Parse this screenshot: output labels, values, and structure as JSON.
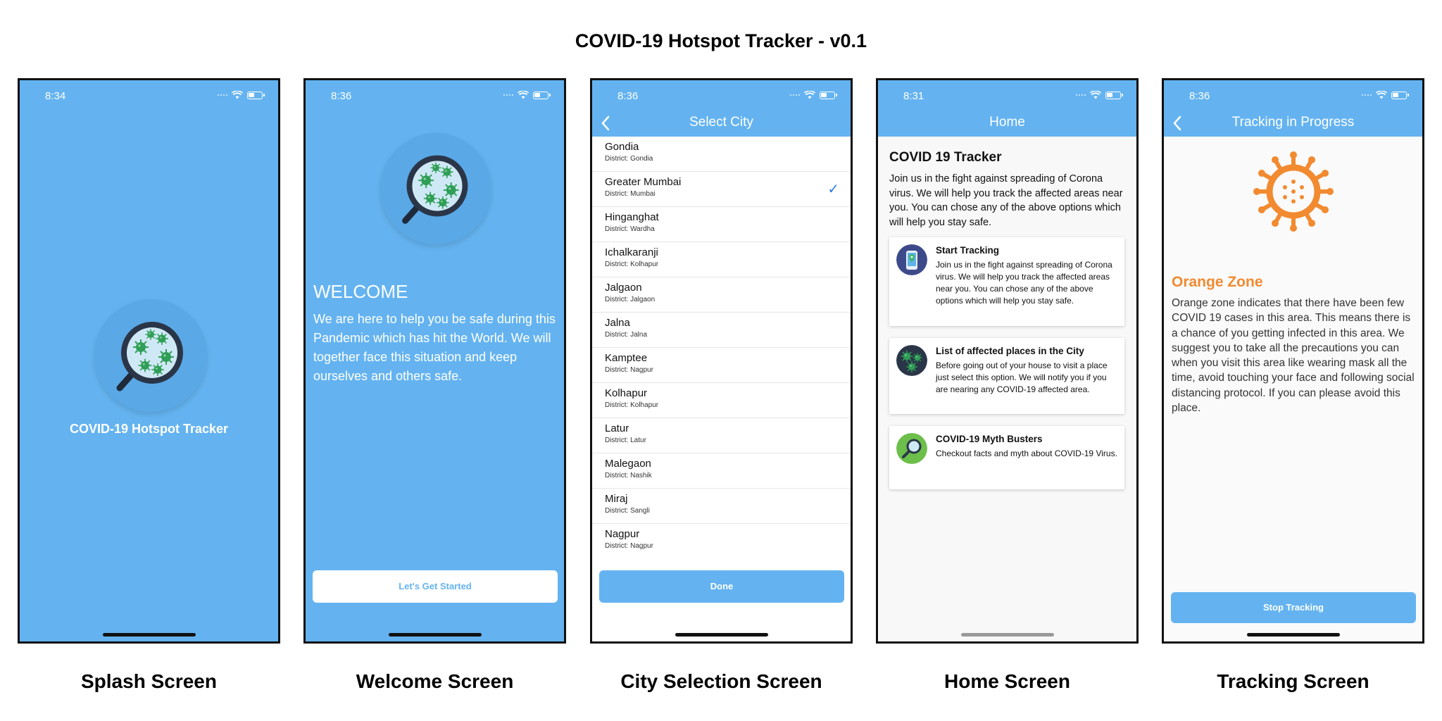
{
  "title": "COVID-19 Hotspot Tracker - v0.1",
  "colors": {
    "primary_blue": "#64b3f0",
    "orange": "#f28a30",
    "check_blue": "#2e7ce8"
  },
  "screens": {
    "splash": {
      "label": "Splash Screen",
      "time": "8:34",
      "app_name": "COVID-19 Hotspot Tracker"
    },
    "welcome": {
      "label": "Welcome Screen",
      "time": "8:36",
      "heading": "WELCOME",
      "text": "We are here to help you be safe during this Pandemic which has hit the World. We will together face this situation and keep ourselves and others safe.",
      "button": "Let's Get Started"
    },
    "city": {
      "label": "City Selection Screen",
      "time": "8:36",
      "nav_title": "Select City",
      "button": "Done",
      "cities": [
        {
          "name": "Gondia",
          "district": "District: Gondia"
        },
        {
          "name": "Greater Mumbai",
          "district": "District: Mumbai"
        },
        {
          "name": "Hinganghat",
          "district": "District: Wardha"
        },
        {
          "name": "Ichalkaranji",
          "district": "District: Kolhapur"
        },
        {
          "name": "Jalgaon",
          "district": "District: Jalgaon"
        },
        {
          "name": "Jalna",
          "district": "District: Jalna"
        },
        {
          "name": "Kamptee",
          "district": "District: Nagpur"
        },
        {
          "name": "Kolhapur",
          "district": "District: Kolhapur"
        },
        {
          "name": "Latur",
          "district": "District: Latur"
        },
        {
          "name": "Malegaon",
          "district": "District: Nashik"
        },
        {
          "name": "Miraj",
          "district": "District: Sangli"
        },
        {
          "name": "Nagpur",
          "district": "District: Nagpur"
        }
      ],
      "selected": "Greater Mumbai"
    },
    "home": {
      "label": "Home Screen",
      "time": "8:31",
      "nav_title": "Home",
      "heading": "COVID 19 Tracker",
      "intro": "Join us in the fight against spreading of Corona virus. We will help you track the affected areas near you. You can chose any of the above options which will help you stay safe.",
      "cards": [
        {
          "title": "Start Tracking",
          "desc": "Join us in the fight against spreading of Corona virus. We will help you track the affected areas near you. You can chose any of the above options which will help you stay safe.",
          "icon": "phone-location-icon"
        },
        {
          "title": "List of affected places in the City",
          "desc": "Before going out of your house to visit a place just select this option. We will notify you if you are nearing any COVID-19 affected area.",
          "icon": "virus-cluster-icon"
        },
        {
          "title": "COVID-19 Myth Busters",
          "desc": "Checkout facts and myth about COVID-19 Virus.",
          "icon": "magnifier-icon"
        }
      ]
    },
    "tracking": {
      "label": "Tracking Screen",
      "time": "8:36",
      "nav_title": "Tracking in Progress",
      "zone": "Orange Zone",
      "text": "Orange zone indicates that there have been few COVID 19 cases in this area. This means there is a chance of you getting infected in this area. We suggest you to take all the precautions you can when you visit this area like wearing mask all the time, avoid touching your face and following social distancing protocol. If you can please avoid this place.",
      "button": "Stop Tracking"
    }
  }
}
